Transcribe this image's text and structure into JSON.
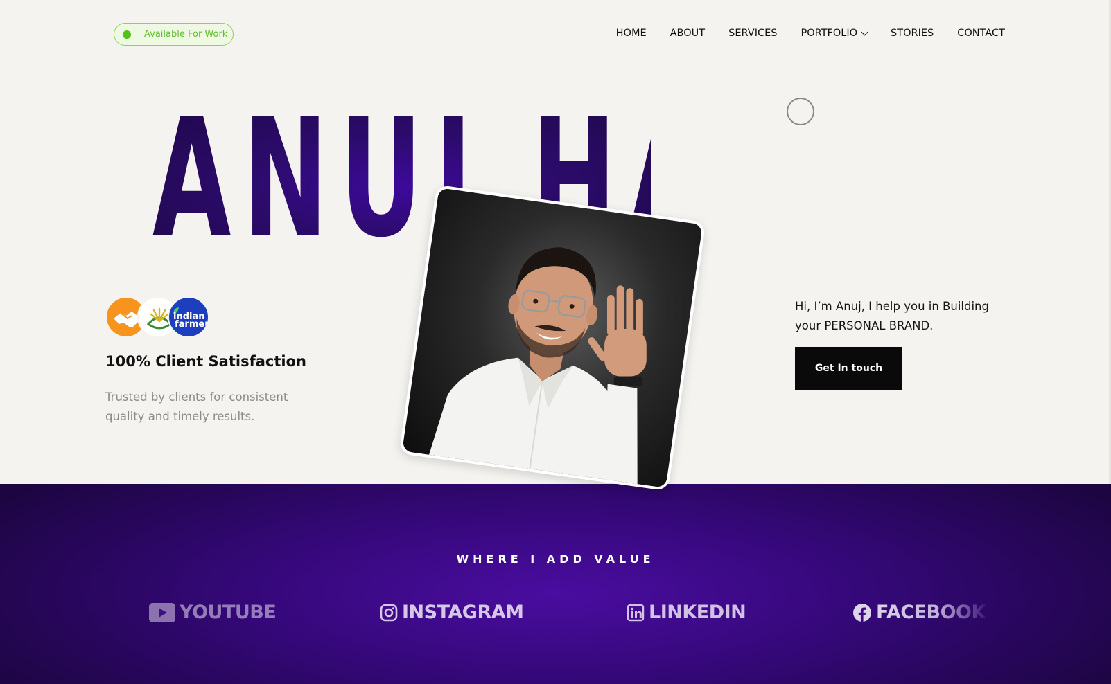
{
  "badge": {
    "label": "Available For Work"
  },
  "nav": {
    "items": [
      {
        "label": "HOME"
      },
      {
        "label": "ABOUT"
      },
      {
        "label": "SERVICES"
      },
      {
        "label": "PORTFOLIO"
      },
      {
        "label": "STORIES"
      },
      {
        "label": "CONTACT"
      }
    ]
  },
  "hero": {
    "name": "ANUJ HAJARI",
    "photo_icon": "portrait-photo"
  },
  "satisfaction": {
    "title": "100% Client Satisfaction",
    "description": "Trusted by clients for consistent quality and timely results.",
    "logos": [
      {
        "icon": "handshake-icon",
        "color": "#f7941d"
      },
      {
        "icon": "plant-logo-icon",
        "color": "#ffffff"
      },
      {
        "icon": "indian-farmer-logo",
        "text_top": "indian",
        "text_bottom": "farmer",
        "color": "#1d3fbf"
      }
    ]
  },
  "intro": {
    "text": "Hi, I’m Anuj, I help you in Building your PERSONAL BRAND.",
    "cta_label": "Get In touch"
  },
  "value_section": {
    "title": "WHERE I ADD VALUE",
    "platforms": [
      {
        "label": "YOUTUBE",
        "icon": "youtube-icon"
      },
      {
        "label": "INSTAGRAM",
        "icon": "instagram-icon"
      },
      {
        "label": "LINKEDIN",
        "icon": "linkedin-icon"
      },
      {
        "label": "FACEBOOK",
        "icon": "facebook-icon"
      }
    ]
  },
  "colors": {
    "background": "#f4f3ef",
    "brand_purple": "#2a0a66",
    "section_purple": "#3a0a88",
    "badge_green": "#4fc414",
    "cta_black": "#0a0a0a"
  }
}
